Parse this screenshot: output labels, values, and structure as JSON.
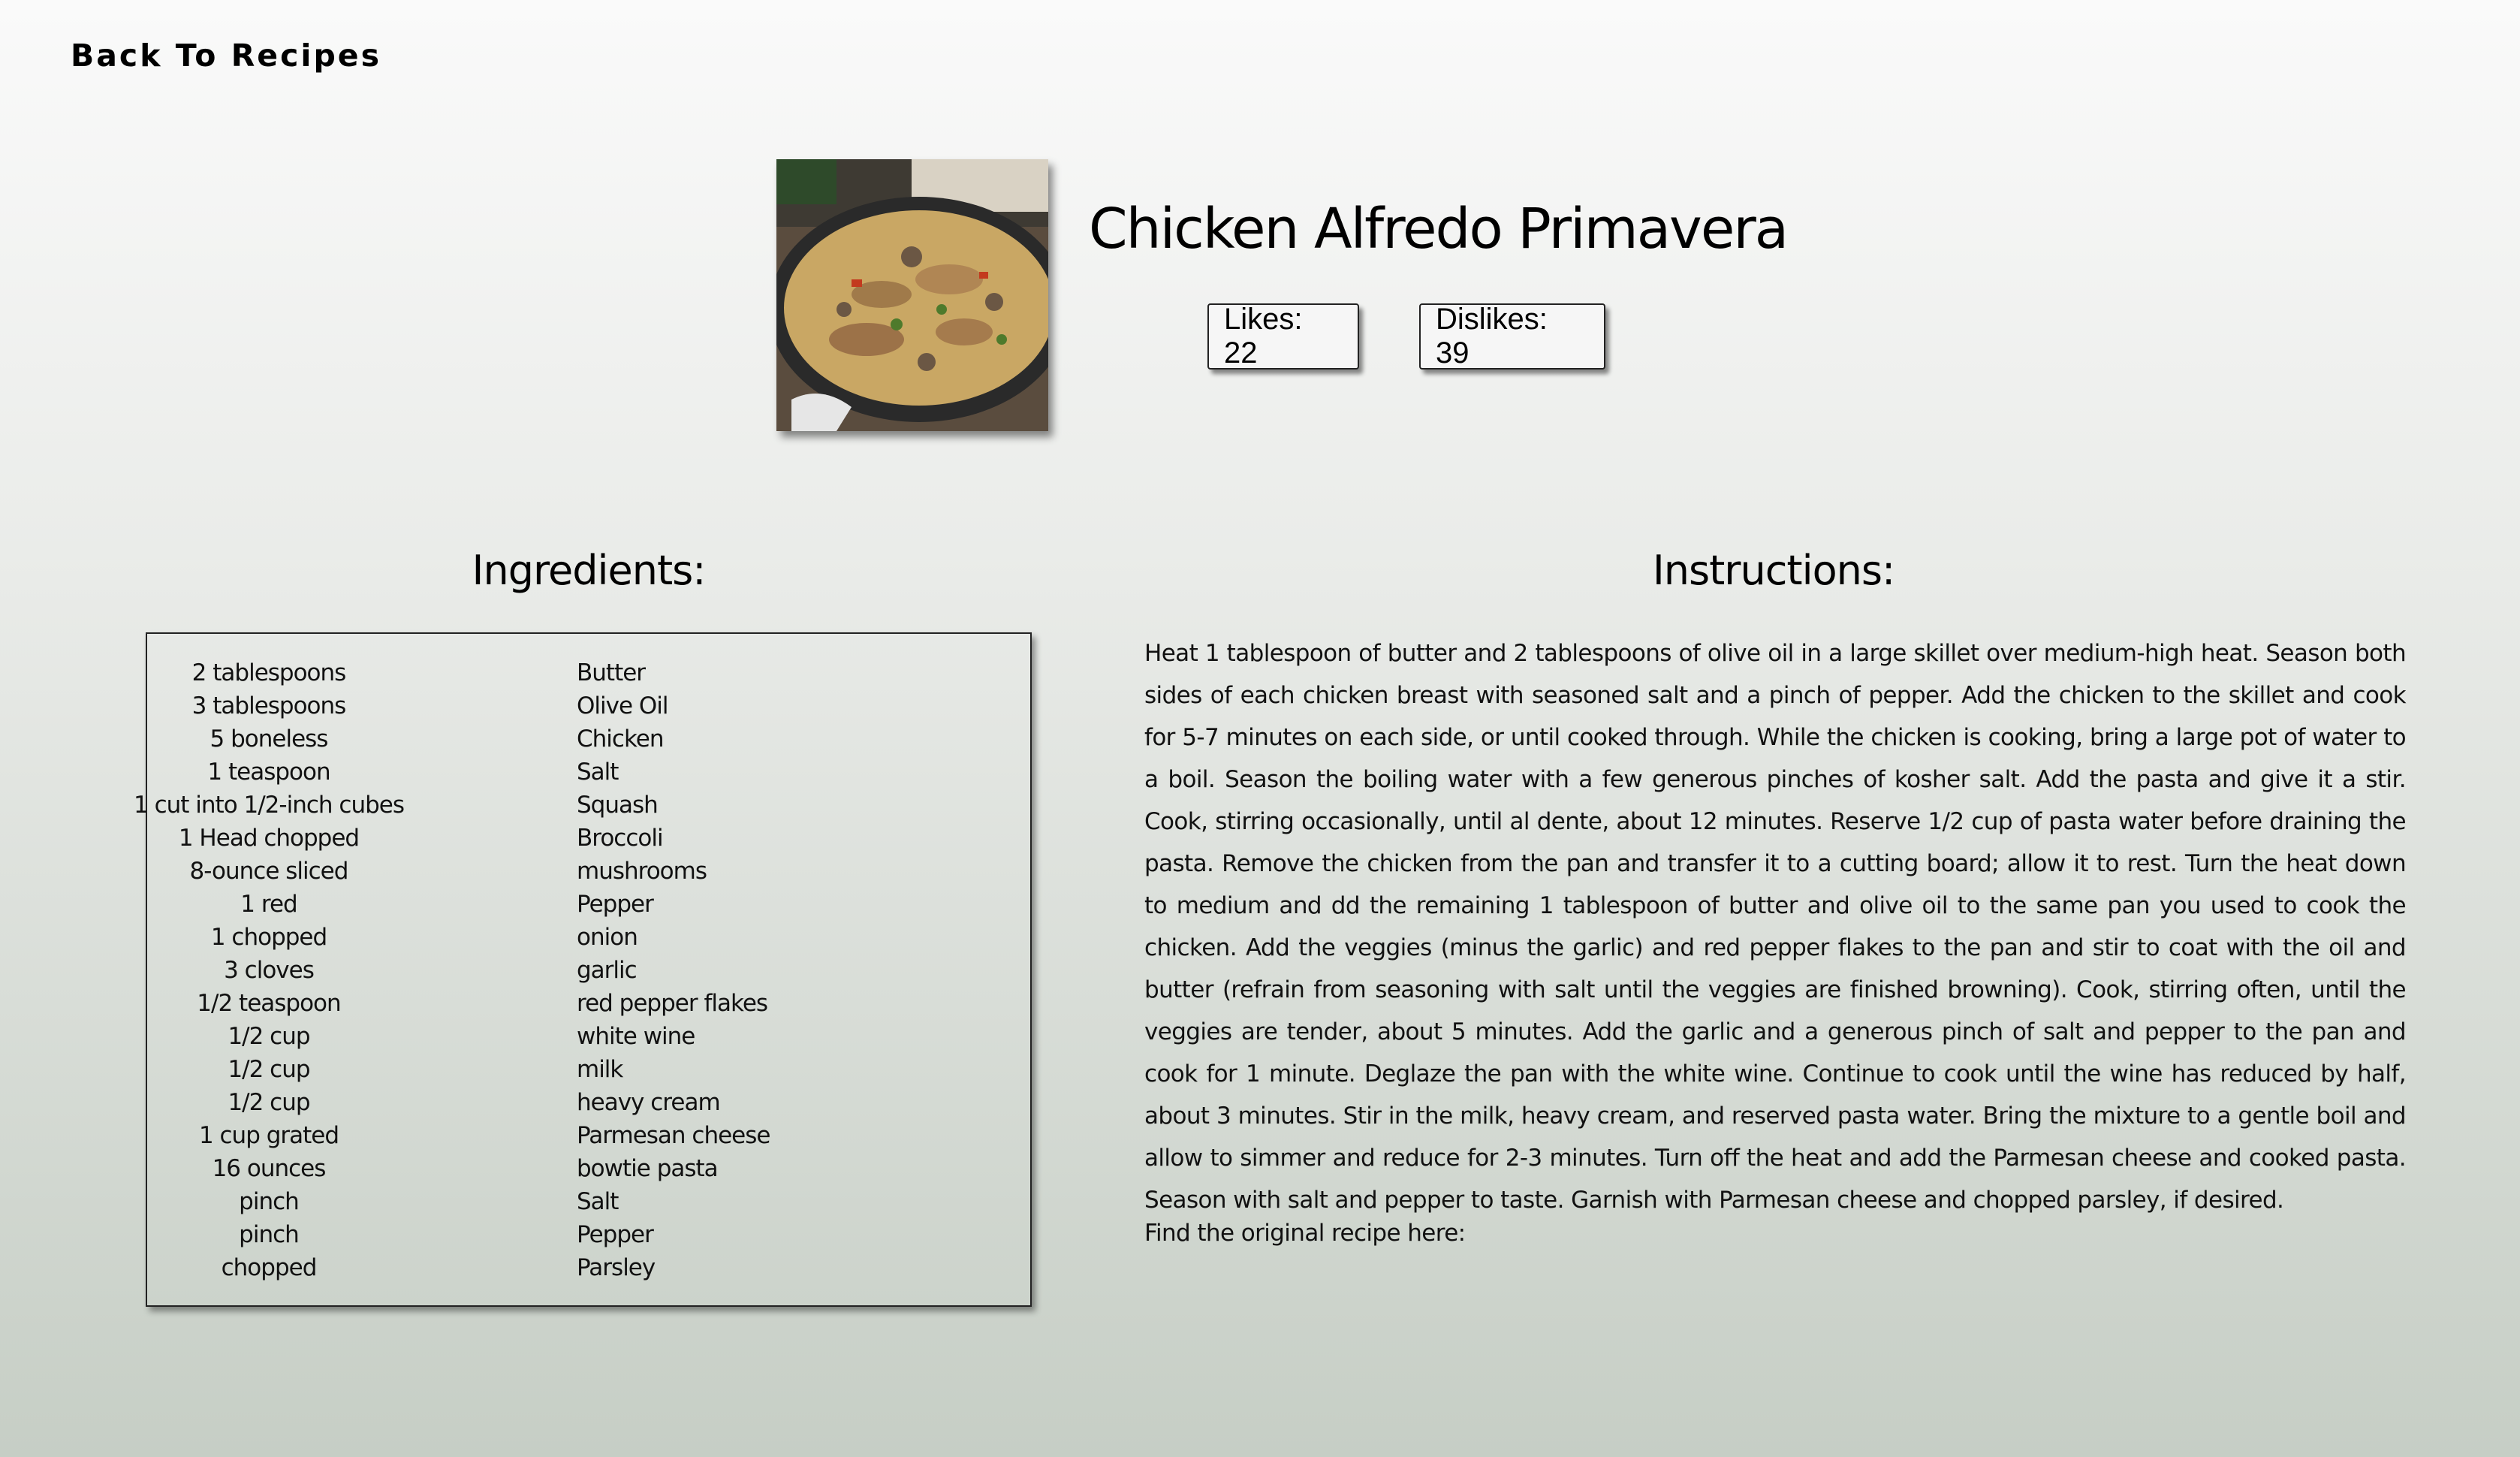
{
  "nav": {
    "back_label": "Back To Recipes"
  },
  "recipe": {
    "title": "Chicken Alfredo Primavera",
    "likes_label": "Likes: 22",
    "dislikes_label": "Dislikes: 39",
    "likes": 22,
    "dislikes": 39
  },
  "ingredients": {
    "heading": "Ingredients:",
    "items": [
      {
        "qty": "2 tablespoons",
        "name": "Butter"
      },
      {
        "qty": "3 tablespoons",
        "name": "Olive Oil"
      },
      {
        "qty": "5 boneless",
        "name": "Chicken"
      },
      {
        "qty": "1 teaspoon",
        "name": "Salt"
      },
      {
        "qty": "1 cut into 1/2-inch cubes",
        "name": "Squash"
      },
      {
        "qty": "1 Head chopped",
        "name": "Broccoli"
      },
      {
        "qty": "8-ounce sliced",
        "name": "mushrooms"
      },
      {
        "qty": "1 red",
        "name": "Pepper"
      },
      {
        "qty": "1 chopped",
        "name": "onion"
      },
      {
        "qty": "3 cloves",
        "name": "garlic"
      },
      {
        "qty": "1/2 teaspoon",
        "name": "red pepper flakes"
      },
      {
        "qty": "1/2 cup",
        "name": "white wine"
      },
      {
        "qty": "1/2 cup",
        "name": "milk"
      },
      {
        "qty": "1/2 cup",
        "name": "heavy cream"
      },
      {
        "qty": "1 cup grated",
        "name": "Parmesan cheese"
      },
      {
        "qty": "16 ounces",
        "name": "bowtie pasta"
      },
      {
        "qty": "pinch",
        "name": "Salt"
      },
      {
        "qty": "pinch",
        "name": "Pepper"
      },
      {
        "qty": "chopped",
        "name": "Parsley"
      }
    ]
  },
  "instructions": {
    "heading": "Instructions:",
    "text": "Heat 1 tablespoon of butter and 2 tablespoons of olive oil in a large skillet over medium-high heat. Season both sides of each chicken breast with seasoned salt and a pinch of pepper. Add the chicken to the skillet and cook for 5-7 minutes on each side, or until cooked through. While the chicken is cooking, bring a large pot of water to a boil. Season the boiling water with a few generous pinches of kosher salt. Add the pasta and give it a stir. Cook, stirring occasionally, until al dente, about 12 minutes. Reserve 1/2 cup of pasta water before draining the pasta. Remove the chicken from the pan and transfer it to a cutting board; allow it to rest. Turn the heat down to medium and dd the remaining 1 tablespoon of butter and olive oil to the same pan you used to cook the chicken. Add the veggies (minus the garlic) and red pepper flakes to the pan and stir to coat with the oil and butter (refrain from seasoning with salt until the veggies are finished browning). Cook, stirring often, until the veggies are tender, about 5 minutes. Add the garlic and a generous pinch of salt and pepper to the pan and cook for 1 minute. Deglaze the pan with the white wine. Continue to cook until the wine has reduced by half, about 3 minutes. Stir in the milk, heavy cream, and reserved pasta water. Bring the mixture to a gentle boil and allow to simmer and reduce for 2-3 minutes. Turn off the heat and add the Parmesan cheese and cooked pasta. Season with salt and pepper to taste. Garnish with Parmesan cheese and chopped parsley, if desired.",
    "original_label": "Find the original recipe here:"
  },
  "colors": {
    "background_top": "#fafafa",
    "background_bottom": "#c6cec5",
    "text": "#111111",
    "border": "#222222"
  },
  "icons": {
    "recipe_photo": "skillet-pasta-image"
  }
}
